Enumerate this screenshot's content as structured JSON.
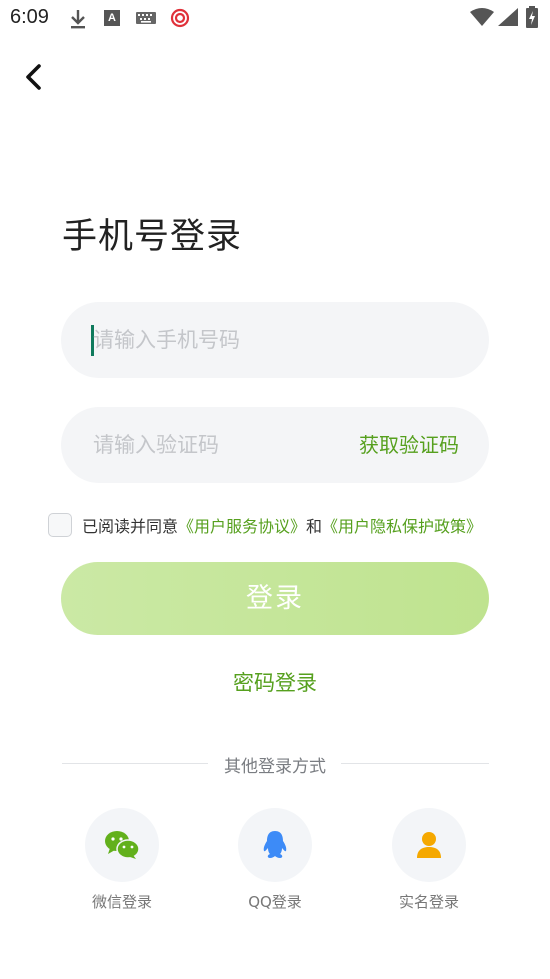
{
  "status_bar": {
    "time": "6:09",
    "icons": [
      "download-icon",
      "a-icon",
      "keyboard-icon",
      "target-icon",
      "wifi-icon",
      "signal-icon",
      "battery-icon"
    ],
    "a_glyph": "A"
  },
  "header": {
    "back_icon": "chevron-left-icon"
  },
  "title": "手机号登录",
  "phone_input": {
    "placeholder": "请输入手机号码",
    "value": ""
  },
  "code_input": {
    "placeholder": "请输入验证码",
    "value": "",
    "get_code_label": "获取验证码"
  },
  "agreement": {
    "checked": false,
    "prefix": "已阅读并同意",
    "terms_link": "《用户服务协议》",
    "conjunction": "和",
    "privacy_link": "《用户隐私保护政策》"
  },
  "login_button": "登录",
  "password_login": "密码登录",
  "other_login": {
    "label": "其他登录方式",
    "options": [
      {
        "label": "微信登录",
        "icon": "wechat-icon",
        "color": "#62b01c"
      },
      {
        "label": "QQ登录",
        "icon": "qq-icon",
        "color": "#3d8bf7"
      },
      {
        "label": "实名登录",
        "icon": "person-icon",
        "color": "#f5a800"
      }
    ]
  },
  "colors": {
    "accent": "#56a01e",
    "button_bg": "#c6e79a",
    "field_bg": "#f4f5f7"
  }
}
